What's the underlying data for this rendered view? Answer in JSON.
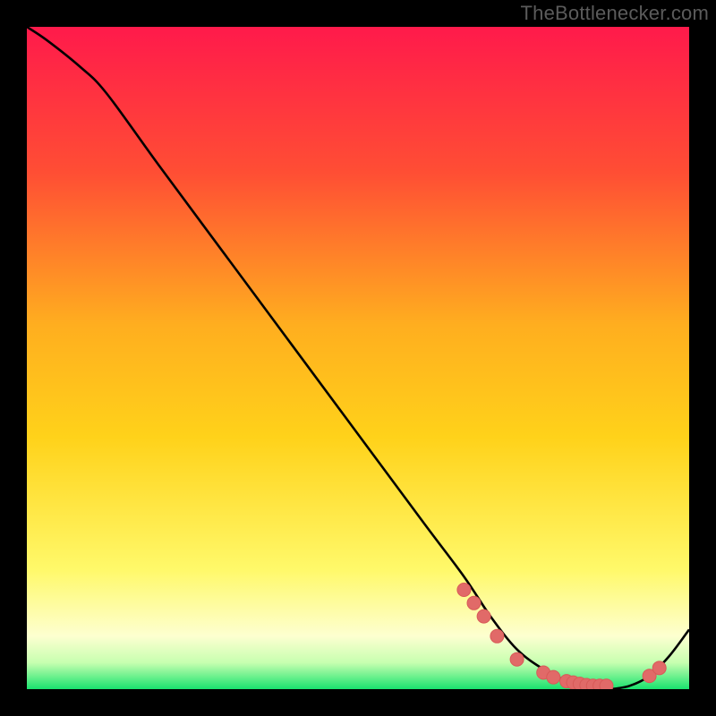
{
  "watermark": "TheBottlenecker.com",
  "colors": {
    "background": "#000000",
    "gradient_top": "#ff1a4b",
    "gradient_mid_upper": "#ff6a2a",
    "gradient_mid": "#ffd21a",
    "gradient_mid_lower": "#fff760",
    "gradient_lower": "#feffd6",
    "gradient_bottom": "#19e36e",
    "curve": "#000000",
    "marker_fill": "#e16a68",
    "marker_stroke": "#d85a58"
  },
  "chart_data": {
    "type": "line",
    "title": "",
    "xlabel": "",
    "ylabel": "",
    "xlim": [
      0,
      100
    ],
    "ylim": [
      0,
      100
    ],
    "x": [
      0,
      3,
      8,
      12,
      20,
      30,
      40,
      50,
      60,
      66,
      70,
      74,
      78,
      82,
      85,
      88,
      91,
      94,
      97,
      100
    ],
    "values": [
      100,
      98,
      94,
      90,
      79,
      65.5,
      52,
      38.5,
      25,
      17,
      11,
      6,
      3,
      1,
      0,
      0,
      0.5,
      2,
      5,
      9
    ],
    "markers": [
      {
        "x": 66.0,
        "y": 15.0
      },
      {
        "x": 67.5,
        "y": 13.0
      },
      {
        "x": 69.0,
        "y": 11.0
      },
      {
        "x": 71.0,
        "y": 8.0
      },
      {
        "x": 74.0,
        "y": 4.5
      },
      {
        "x": 78.0,
        "y": 2.5
      },
      {
        "x": 79.5,
        "y": 1.8
      },
      {
        "x": 81.5,
        "y": 1.2
      },
      {
        "x": 82.5,
        "y": 1.0
      },
      {
        "x": 83.5,
        "y": 0.8
      },
      {
        "x": 84.5,
        "y": 0.6
      },
      {
        "x": 85.5,
        "y": 0.5
      },
      {
        "x": 86.5,
        "y": 0.5
      },
      {
        "x": 87.5,
        "y": 0.5
      },
      {
        "x": 94.0,
        "y": 2.0
      },
      {
        "x": 95.5,
        "y": 3.2
      }
    ]
  }
}
